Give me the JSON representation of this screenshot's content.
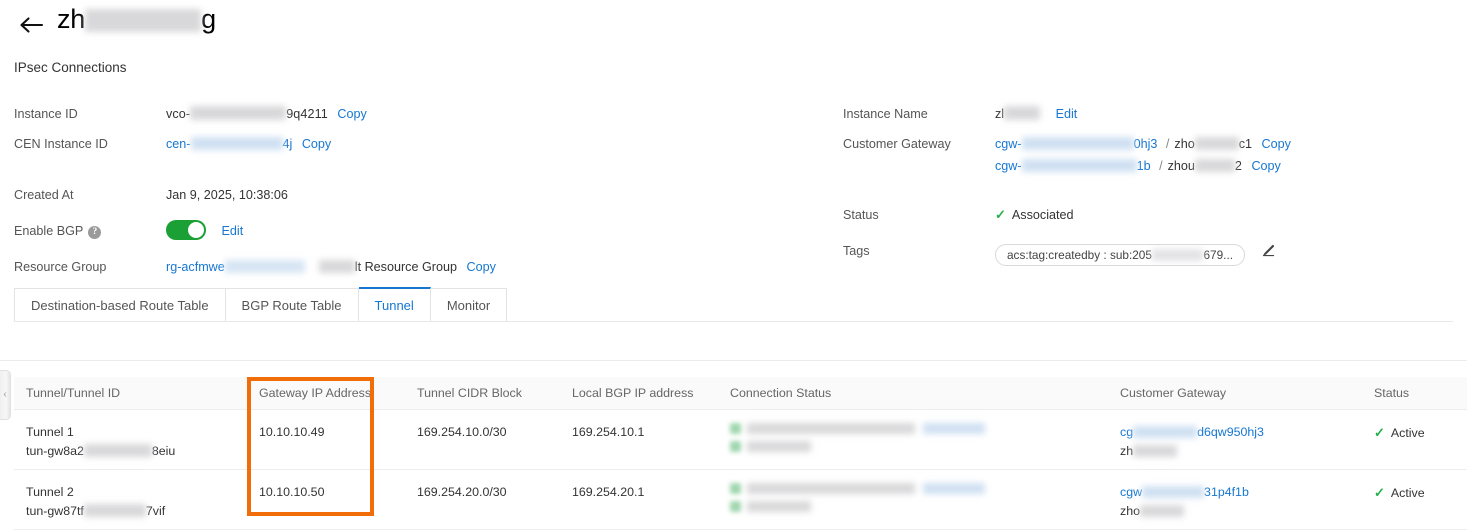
{
  "header": {
    "back_icon": "back-arrow-icon",
    "title_prefix": "zh",
    "title_suffix": "g",
    "subtitle": "IPsec Connections"
  },
  "details": {
    "left": [
      {
        "label": "Instance ID",
        "value_prefix": "vco-",
        "value_suffix": "9q4211",
        "copy": "Copy",
        "link": false,
        "redacted": true
      },
      {
        "label": "CEN Instance ID",
        "value_prefix": "cen-",
        "value_suffix": "4j",
        "copy": "Copy",
        "link": true,
        "redacted": true
      },
      {
        "label": "Created At",
        "value_prefix": "Jan 9, 2025, 10:38:06",
        "value_suffix": "",
        "copy": "",
        "link": false,
        "redacted": false
      },
      {
        "label": "Enable BGP",
        "help_icon": "question-mark-icon",
        "toggle_on": true,
        "edit": "Edit"
      },
      {
        "label": "Resource Group",
        "value_prefix": "rg-acfmwe",
        "value_suffix": "lt Resource Group",
        "copy": "Copy",
        "link": true,
        "redacted": true
      }
    ],
    "right": [
      {
        "label": "Instance Name",
        "value_prefix": "zl",
        "edit": "Edit"
      },
      {
        "label": "Customer Gateway",
        "rows": [
          {
            "prefix": "cgw-",
            "suffix": "0hj3",
            "sep": "/",
            "name_prefix": "zho",
            "name_suffix": "c1",
            "copy": "Copy"
          },
          {
            "prefix": "cgw-",
            "suffix": "1b",
            "sep": "/",
            "name_prefix": "zhou",
            "name_suffix": "2",
            "copy": "Copy"
          }
        ]
      },
      {
        "label": "Status",
        "status_icon": "check-icon",
        "status_text": "Associated"
      },
      {
        "label": "Tags",
        "tag_prefix": "acs:tag:createdby : sub:205",
        "tag_suffix": "679...",
        "edit_icon": "pencil-icon"
      }
    ]
  },
  "tabs": [
    {
      "label": "Destination-based Route Table",
      "active": false
    },
    {
      "label": "BGP Route Table",
      "active": false
    },
    {
      "label": "Tunnel",
      "active": true
    },
    {
      "label": "Monitor",
      "active": false
    }
  ],
  "table": {
    "columns": [
      "Tunnel/Tunnel ID",
      "Gateway IP Address",
      "Tunnel CIDR Block",
      "Local BGP IP address",
      "Connection Status",
      "Customer Gateway",
      "Status"
    ],
    "rows": [
      {
        "tunnel_name": "Tunnel 1",
        "tunnel_id_prefix": "tun-gw8a2",
        "tunnel_id_suffix": "8eiu",
        "gateway_ip": "10.10.10.49",
        "tunnel_cidr": "169.254.10.0/30",
        "local_bgp_ip": "169.254.10.1",
        "connection_status_redacted": true,
        "customer_gateway_prefix": "cg",
        "customer_gateway_suffix": "d6qw950hj3",
        "customer_gateway_name_prefix": "zh",
        "status_icon": "check-icon",
        "status_text": "Active"
      },
      {
        "tunnel_name": "Tunnel 2",
        "tunnel_id_prefix": "tun-gw87tf",
        "tunnel_id_suffix": "7vif",
        "gateway_ip": "10.10.10.50",
        "tunnel_cidr": "169.254.20.0/30",
        "local_bgp_ip": "169.254.20.1",
        "connection_status_redacted": true,
        "customer_gateway_prefix": "cgw",
        "customer_gateway_suffix": "31p4f1b",
        "customer_gateway_name_prefix": "zho",
        "status_icon": "check-icon",
        "status_text": "Active"
      }
    ]
  },
  "highlight": {
    "color": "#f06d0a",
    "target_column": "Gateway IP Address"
  },
  "collapse_handle": {
    "icon": "chevron-left-icon"
  },
  "colors": {
    "link": "#1677d2",
    "success": "#23b14d",
    "toggle_on": "#1aa034",
    "highlight": "#f06d0a"
  }
}
